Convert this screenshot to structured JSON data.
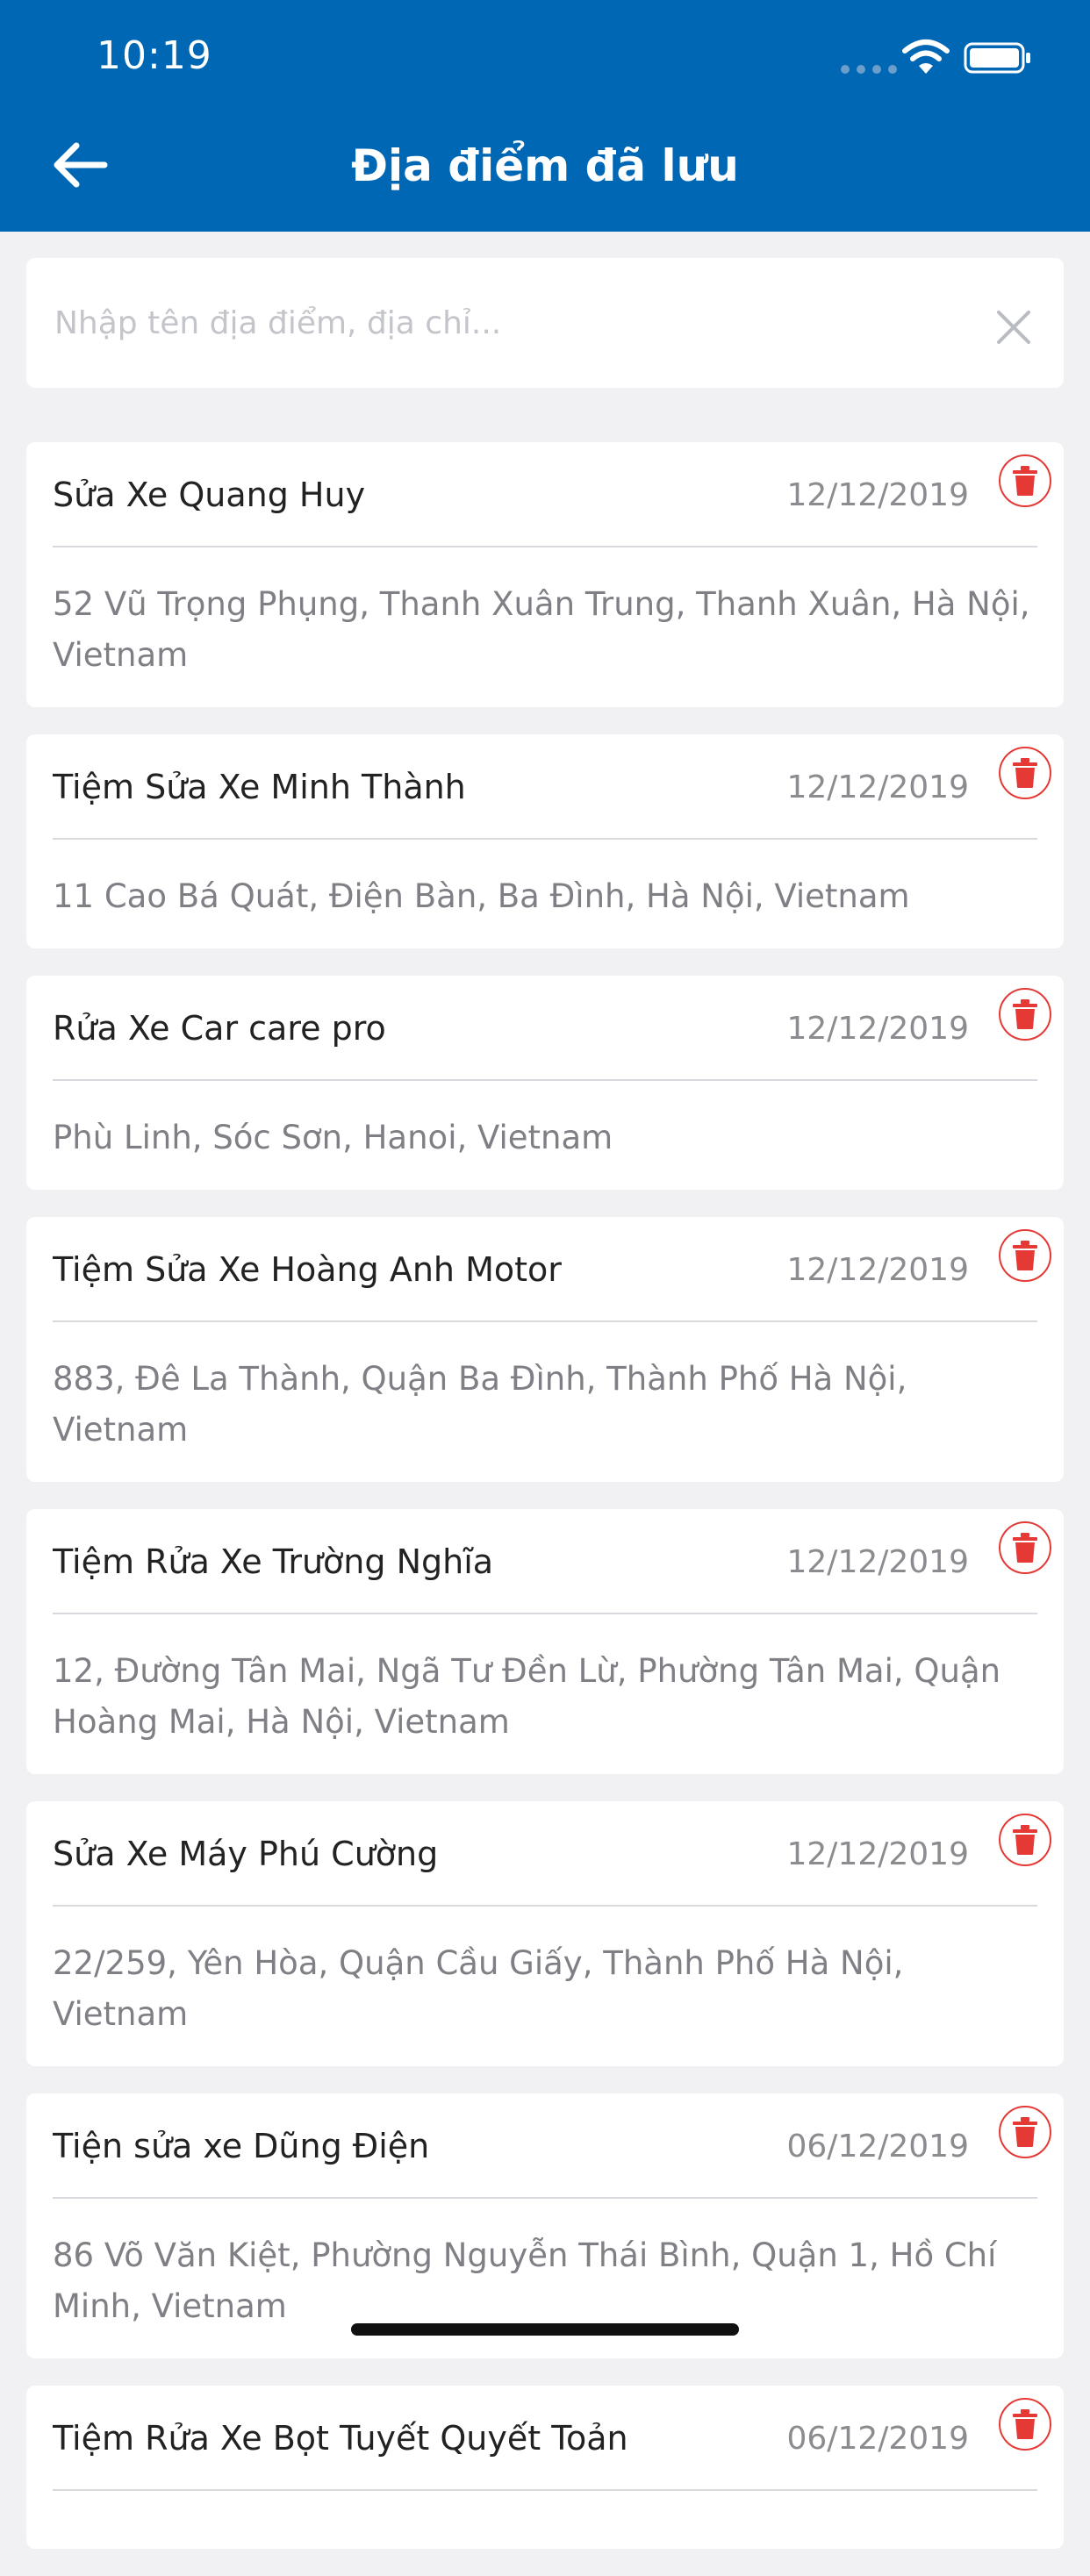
{
  "status_bar": {
    "time": "10:19"
  },
  "header": {
    "title": "Địa điểm đã lưu"
  },
  "search": {
    "placeholder": "Nhập tên địa điểm, địa chỉ..."
  },
  "colors": {
    "header": "#0067b4",
    "delete": "#e53935",
    "background": "#f1f1f4"
  },
  "places": [
    {
      "name": "Sửa Xe Quang Huy",
      "date": "12/12/2019",
      "address": "52 Vũ Trọng Phụng, Thanh Xuân Trung, Thanh Xuân, Hà Nội, Vietnam"
    },
    {
      "name": "Tiệm Sửa Xe Minh Thành",
      "date": "12/12/2019",
      "address": "11 Cao Bá Quát, Điện Bàn, Ba Đình, Hà Nội, Vietnam"
    },
    {
      "name": "Rửa Xe Car care pro",
      "date": "12/12/2019",
      "address": "Phù Linh, Sóc Sơn, Hanoi, Vietnam"
    },
    {
      "name": "Tiệm Sửa Xe Hoàng Anh Motor",
      "date": "12/12/2019",
      "address": "883, Đê La Thành, Quận Ba Đình, Thành Phố Hà Nội, Vietnam"
    },
    {
      "name": "Tiệm Rửa Xe Trường Nghĩa",
      "date": "12/12/2019",
      "address": "12, Đường Tân Mai, Ngã Tư Đền Lừ, Phường Tân Mai, Quận Hoàng Mai, Hà Nội, Vietnam"
    },
    {
      "name": "Sửa Xe Máy Phú Cường",
      "date": "12/12/2019",
      "address": "22/259, Yên Hòa, Quận Cầu Giấy, Thành Phố Hà Nội, Vietnam"
    },
    {
      "name": "Tiện sửa xe Dũng Điện",
      "date": "06/12/2019",
      "address": "86 Võ Văn Kiệt, Phường Nguyễn Thái Bình, Quận 1, Hồ Chí Minh, Vietnam"
    },
    {
      "name": "Tiệm Rửa Xe Bọt Tuyết Quyết Toản",
      "date": "06/12/2019",
      "address": ""
    }
  ]
}
